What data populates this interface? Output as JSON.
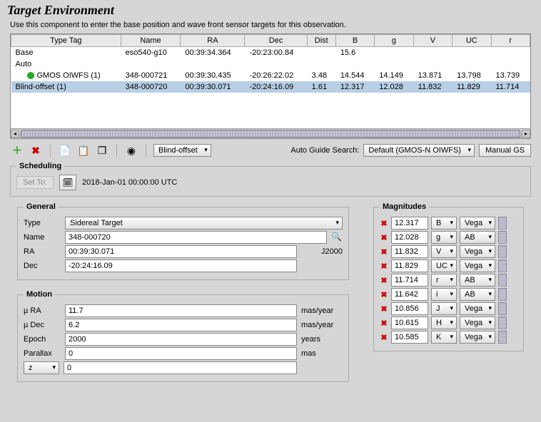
{
  "title": "Target Environment",
  "subtitle": "Use this component to enter the base position and wave front sensor targets for this observation.",
  "table": {
    "headers": [
      "Type Tag",
      "Name",
      "RA",
      "Dec",
      "Dist",
      "B",
      "g",
      "V",
      "UC",
      "r"
    ],
    "rows": [
      {
        "tag": "Base",
        "name": "eso540-g10",
        "ra": "00:39:34.364",
        "dec": "-20:23:00.84",
        "dist": "",
        "b": "15.6",
        "g": "",
        "v": "",
        "uc": "",
        "r": ""
      },
      {
        "tag": "Auto",
        "name": "",
        "ra": "",
        "dec": "",
        "dist": "",
        "b": "",
        "g": "",
        "v": "",
        "uc": "",
        "r": ""
      },
      {
        "tag": "GMOS OIWFS (1)",
        "name": "348-000721",
        "ra": "00:39:30.435",
        "dec": "-20:26:22.02",
        "dist": "3.48",
        "b": "14.544",
        "g": "14.149",
        "v": "13.871",
        "uc": "13.798",
        "r": "13.739",
        "dot": true,
        "indent": true
      },
      {
        "tag": "Blind-offset (1)",
        "name": "348-000720",
        "ra": "00:39:30.071",
        "dec": "-20:24:16.09",
        "dist": "1.61",
        "b": "12.317",
        "g": "12.028",
        "v": "11.832",
        "uc": "11.829",
        "r": "11.714",
        "selected": true
      }
    ]
  },
  "toolbar": {
    "offset_dropdown": "Blind-offset",
    "autoguide_label": "Auto Guide Search:",
    "autoguide_value": "Default (GMOS-N OIWFS)",
    "manual_gs": "Manual GS"
  },
  "scheduling": {
    "legend": "Scheduling",
    "set_to": "Set To:",
    "datetime": "2018-Jan-01 00:00:00 UTC"
  },
  "general": {
    "legend": "General",
    "type_label": "Type",
    "type_value": "Sidereal Target",
    "name_label": "Name",
    "name_value": "348-000720",
    "ra_label": "RA",
    "ra_value": "00:39:30.071",
    "dec_label": "Dec",
    "dec_value": "-20:24:16.09",
    "epoch_label": "J2000"
  },
  "motion": {
    "legend": "Motion",
    "rows": [
      {
        "label": "µ RA",
        "value": "11.7",
        "unit": "mas/year"
      },
      {
        "label": "µ Dec",
        "value": "6.2",
        "unit": "mas/year"
      },
      {
        "label": "Epoch",
        "value": "2000",
        "unit": "years"
      },
      {
        "label": "Parallax",
        "value": "0",
        "unit": "mas"
      }
    ],
    "z_label": "z",
    "z_value": "0"
  },
  "magnitudes": {
    "legend": "Magnitudes",
    "rows": [
      {
        "val": "12.317",
        "band": "B",
        "sys": "Vega"
      },
      {
        "val": "12.028",
        "band": "g",
        "sys": "AB"
      },
      {
        "val": "11.832",
        "band": "V",
        "sys": "Vega"
      },
      {
        "val": "11.829",
        "band": "UC",
        "sys": "Vega"
      },
      {
        "val": "11.714",
        "band": "r",
        "sys": "AB"
      },
      {
        "val": "11.642",
        "band": "i",
        "sys": "AB"
      },
      {
        "val": "10.856",
        "band": "J",
        "sys": "Vega"
      },
      {
        "val": "10.615",
        "band": "H",
        "sys": "Vega"
      },
      {
        "val": "10.585",
        "band": "K",
        "sys": "Vega"
      }
    ]
  }
}
